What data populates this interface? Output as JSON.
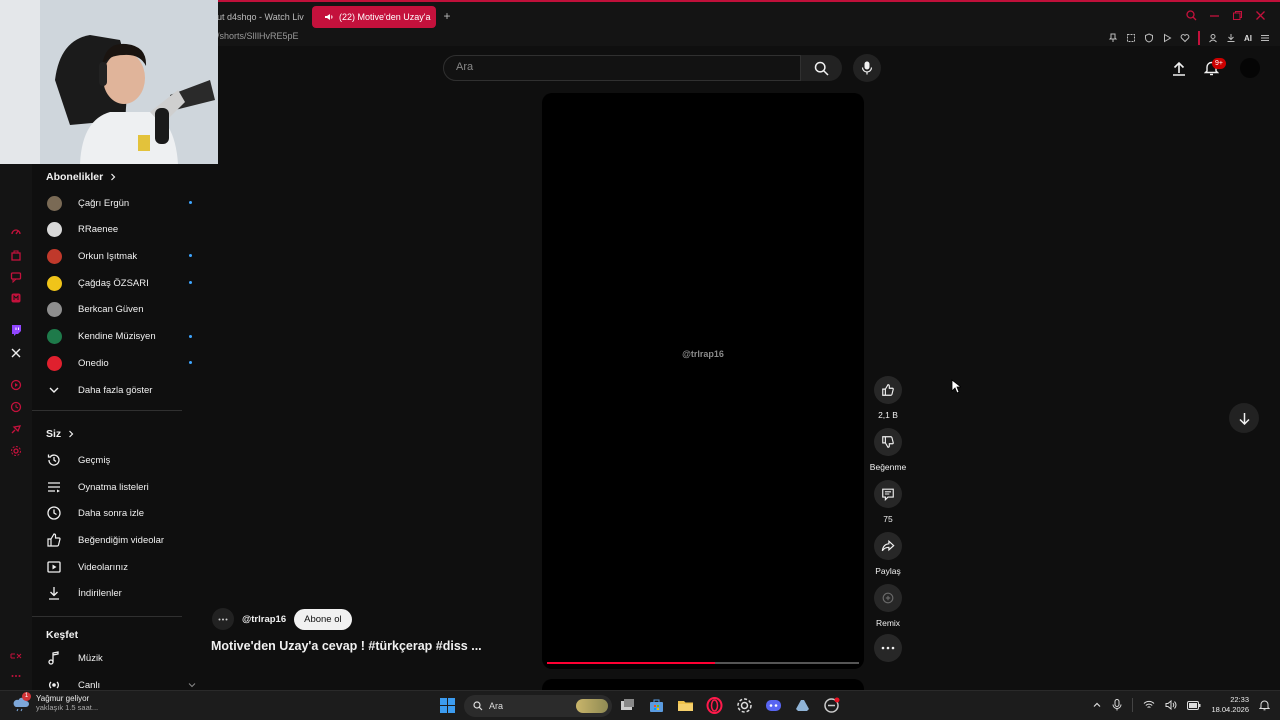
{
  "browser": {
    "tabs": [
      {
        "label": "ut d4shqo - Watch Liv"
      },
      {
        "label": "(22) Motive'den Uzay'a"
      }
    ],
    "url": "/shorts/SlIlHvRE5pE",
    "ai_label": "AI"
  },
  "header": {
    "search_placeholder": "Ara",
    "notification_badge": "9+"
  },
  "sidebar": {
    "subscriptions_title": "Abonelikler",
    "subscriptions": [
      {
        "label": "Çağrı Ergün",
        "new": true,
        "color": "#7a6a55"
      },
      {
        "label": "RRaenee",
        "new": false,
        "color": "#d8d8d8"
      },
      {
        "label": "Orkun Işıtmak",
        "new": true,
        "color": "#c0392b"
      },
      {
        "label": "Çağdaş ÖZSARI",
        "new": true,
        "color": "#f0c419"
      },
      {
        "label": "Berkcan Güven",
        "new": false,
        "color": "#8e8e8e"
      },
      {
        "label": "Kendine Müzisyen",
        "new": true,
        "color": "#1e7a4a"
      },
      {
        "label": "Onedio",
        "new": true,
        "color": "#e0202e"
      }
    ],
    "show_more": "Daha fazla göster",
    "you_title": "Siz",
    "you_items": [
      {
        "label": "Geçmiş"
      },
      {
        "label": "Oynatma listeleri"
      },
      {
        "label": "Daha sonra izle"
      },
      {
        "label": "Beğendiğim videolar"
      },
      {
        "label": "Videolarınız"
      },
      {
        "label": "İndirilenler"
      }
    ],
    "explore_title": "Keşfet",
    "explore_items": [
      {
        "label": "Müzik"
      },
      {
        "label": "Canlı"
      }
    ]
  },
  "player": {
    "watermark": "@trlrap16",
    "progress": 0.54
  },
  "actions": {
    "like_count": "2,1 B",
    "dislike_label": "Beğenme",
    "comment_count": "75",
    "share_label": "Paylaş",
    "remix_label": "Remix"
  },
  "video": {
    "channel": "@trlrap16",
    "subscribe_label": "Abone ol",
    "title": "Motive'den Uzay'a cevap ! #türkçerap #diss ..."
  },
  "taskbar": {
    "weather_title": "Yağmur geliyor",
    "weather_sub": "yaklaşık 1.5 saat...",
    "weather_badge": "1",
    "search_label": "Ara",
    "time": "22:33",
    "date": "18.04.2026"
  },
  "colors": {
    "accent": "#c4113c",
    "youtube_red": "#ff0033",
    "background": "#0f0f0f"
  }
}
